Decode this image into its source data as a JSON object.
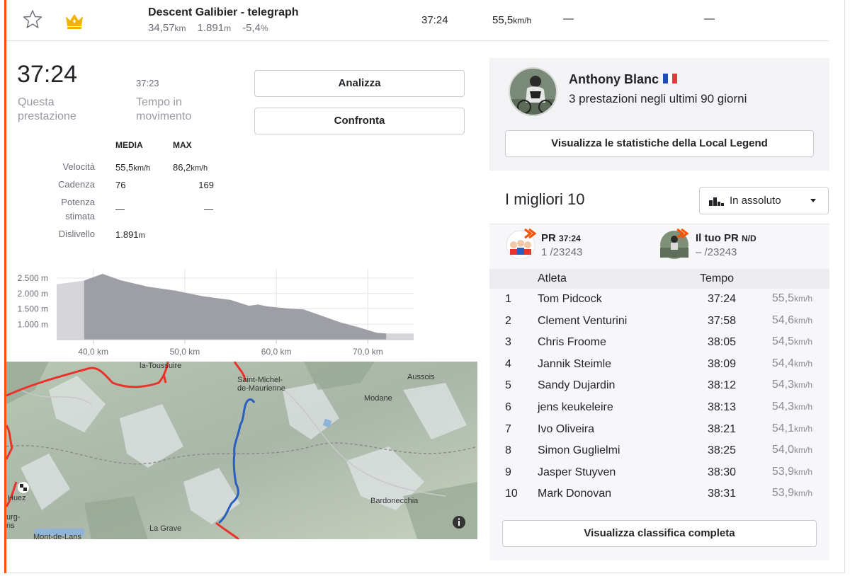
{
  "segment": {
    "name": "Descent Galibier - telegraph",
    "distance": "34,57",
    "distance_unit": "km",
    "elevation": "1.891",
    "elevation_unit": "m",
    "grade": "-5,4",
    "grade_unit": "%",
    "time": "37:24",
    "speed": "55,5",
    "speed_unit": "km/h",
    "col_a": "—",
    "col_b": "—"
  },
  "performance": {
    "elapsed_time": "37:24",
    "elapsed_label": "Questa prestazione",
    "moving_time": "37:23",
    "moving_label": "Tempo in movimento",
    "analyze_label": "Analizza",
    "compare_label": "Confronta"
  },
  "stats": {
    "col_avg": "MEDIA",
    "col_max": "MAX",
    "rows": [
      {
        "label": "Velocità",
        "avg": "55,5",
        "avg_unit": "km/h",
        "max": "86,2",
        "max_unit": "km/h"
      },
      {
        "label": "Cadenza",
        "avg": "76",
        "max": "169"
      },
      {
        "label": "Potenza stimata",
        "avg": "—",
        "max": "—"
      },
      {
        "label": "Dislivello",
        "avg": "1.891",
        "avg_unit": "m"
      }
    ]
  },
  "chart_data": {
    "type": "area",
    "title": "",
    "xlabel": "",
    "ylabel": "",
    "x_ticks": [
      "40,0 km",
      "50,0 km",
      "60,0 km",
      "70,0 km"
    ],
    "y_ticks": [
      "2.500 m",
      "2.000 m",
      "1.500 m",
      "1.000 m"
    ],
    "xlim": [
      36,
      75
    ],
    "ylim": [
      500,
      2800
    ],
    "x": [
      36,
      39,
      41,
      43,
      46,
      49,
      52,
      55,
      57,
      58,
      59,
      61,
      63,
      65,
      67,
      69,
      71,
      72,
      75
    ],
    "values": [
      2300,
      2420,
      2640,
      2430,
      2220,
      2090,
      1910,
      1790,
      1600,
      1640,
      1580,
      1520,
      1480,
      1270,
      1060,
      900,
      720,
      700,
      700
    ],
    "highlight_range": [
      39,
      72
    ],
    "grid": true
  },
  "map": {
    "labels": [
      "la-Toussuire",
      "Saint-Michel-de-Maurienne",
      "Aussois",
      "Modane",
      "Bardonecchia",
      "La Grave",
      "Mont-de-Lans",
      "Huez",
      "urg-ns"
    ],
    "info_icon": "info-icon",
    "finish_icon": "checkered-flag-icon"
  },
  "local_legend": {
    "name": "Anthony Blanc",
    "flag": "france-flag-icon",
    "subtitle": "3 prestazioni negli ultimi 90 giorni",
    "button_label": "Visualizza le statistiche della Local Legend"
  },
  "leaderboard": {
    "title": "I migliori 10",
    "filter_value": "In assoluto",
    "pr_label": "PR",
    "pr_time": "37:24",
    "pr_rank": "1",
    "pr_total": "/23243",
    "your_pr_label": "Il tuo PR",
    "your_pr_value": "N/D",
    "your_pr_rank": "–",
    "your_pr_total": "/23243",
    "col_athlete": "Atleta",
    "col_time": "Tempo",
    "speed_unit": "km/h",
    "rows": [
      {
        "rank": "1",
        "name": "Tom Pidcock",
        "time": "37:24",
        "speed": "55,5"
      },
      {
        "rank": "2",
        "name": "Clement Venturini",
        "time": "37:58",
        "speed": "54,6"
      },
      {
        "rank": "3",
        "name": "Chris Froome",
        "time": "38:05",
        "speed": "54,5"
      },
      {
        "rank": "4",
        "name": "Jannik Steimle",
        "time": "38:09",
        "speed": "54,4"
      },
      {
        "rank": "5",
        "name": "Sandy Dujardin",
        "time": "38:12",
        "speed": "54,3"
      },
      {
        "rank": "6",
        "name": "jens keukeleire",
        "time": "38:13",
        "speed": "54,3"
      },
      {
        "rank": "7",
        "name": "Ivo Oliveira",
        "time": "38:21",
        "speed": "54,1"
      },
      {
        "rank": "8",
        "name": "Simon Guglielmi",
        "time": "38:25",
        "speed": "54,0"
      },
      {
        "rank": "9",
        "name": "Jasper Stuyven",
        "time": "38:30",
        "speed": "53,9"
      },
      {
        "rank": "10",
        "name": "Mark Donovan",
        "time": "38:31",
        "speed": "53,9"
      }
    ],
    "full_button_label": "Visualizza classifica completa"
  },
  "colors": {
    "accent": "#fc5200",
    "crown": "#f0b400",
    "route_red": "#e8322b",
    "route_blue": "#2a5fbf"
  }
}
